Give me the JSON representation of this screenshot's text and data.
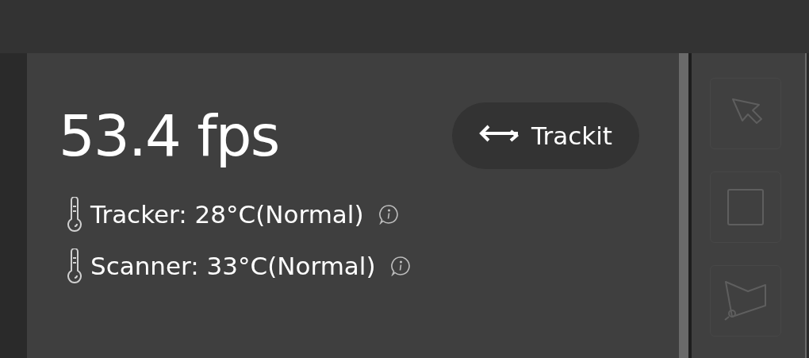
{
  "fps": "53.4 fps",
  "trackit_button": {
    "label": "Trackit"
  },
  "temperatures": [
    {
      "label": "Tracker: 28°C(Normal)"
    },
    {
      "label": "Scanner: 33°C(Normal)"
    }
  ],
  "tools": [
    {
      "kind": "pointer"
    },
    {
      "kind": "rectangle"
    },
    {
      "kind": "polygon"
    }
  ]
}
